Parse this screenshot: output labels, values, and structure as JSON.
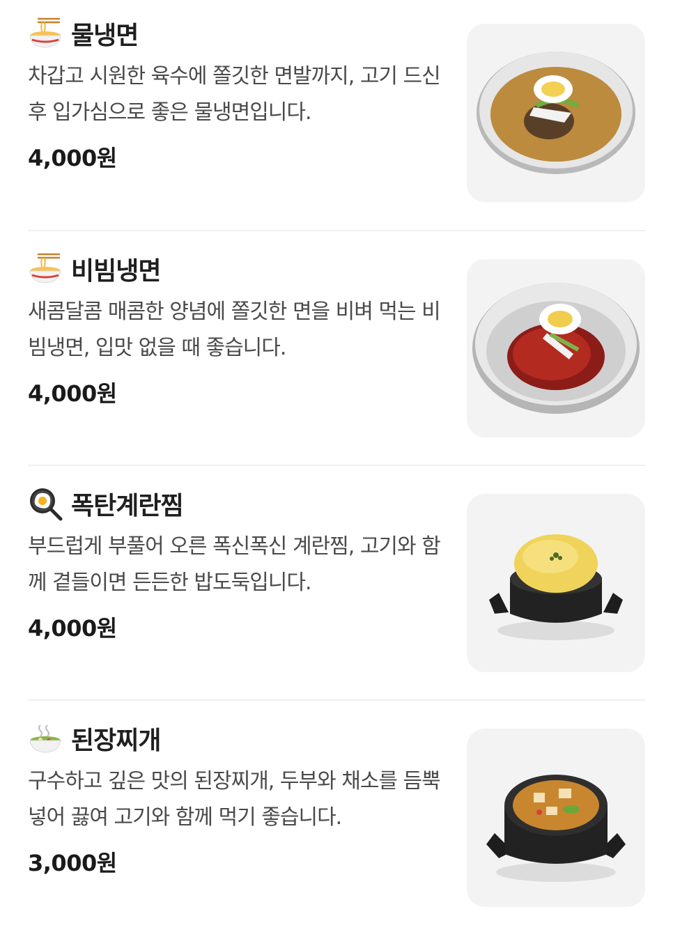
{
  "menu": {
    "items": [
      {
        "emoji": "noodle-bowl-icon",
        "title": "물냉면",
        "description": "차갑고 시원한 육수에 쫄깃한 면발까지, 고기 드신 후 입가심으로 좋은 물냉면입니다.",
        "price": "4,000원",
        "image": "cold-noodle-soup-image"
      },
      {
        "emoji": "noodle-bowl-icon",
        "title": "비빔냉면",
        "description": "새콤달콤 매콤한 양념에 쫄깃한 면을 비벼 먹는 비빔냉면, 입맛 없을 때 좋습니다.",
        "price": "4,000원",
        "image": "spicy-mixed-noodle-image"
      },
      {
        "emoji": "frying-pan-egg-icon",
        "title": "폭탄계란찜",
        "description": "부드럽게 부풀어 오른 폭신폭신 계란찜, 고기와 함께 곁들이면 든든한 밥도둑입니다.",
        "price": "4,000원",
        "image": "steamed-egg-pot-image"
      },
      {
        "emoji": "stew-bowl-icon",
        "title": "된장찌개",
        "description": "구수하고 깊은 맛의 된장찌개, 두부와 채소를 듬뿍 넣어 끓여 고기와 함께 먹기 좋습니다.",
        "price": "3,000원",
        "image": "soybean-stew-pot-image"
      }
    ]
  },
  "colors": {
    "thumb_bg": "#f3f3f3",
    "divider": "#f0f0f0",
    "title": "#1f1f1f",
    "desc": "#4a4a4a"
  }
}
